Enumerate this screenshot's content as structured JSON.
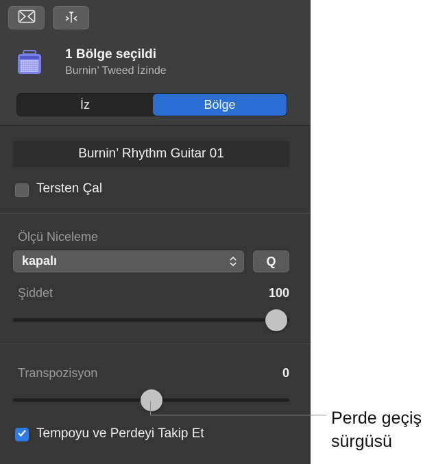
{
  "toolbar": {
    "buttons": [
      {
        "icon": "region-inspector-icon"
      },
      {
        "icon": "catch-playhead-icon"
      }
    ]
  },
  "header": {
    "title": "1 Bölge seçildi",
    "subtitle": "Burnin’ Tweed İzinde",
    "icon": "amp-icon"
  },
  "tabs": {
    "left_label": "İz",
    "right_label": "Bölge",
    "selected": "Bölge"
  },
  "region": {
    "name": "Burnin’ Rhythm Guitar 01",
    "reverse_label": "Tersten Çal",
    "reverse_checked": false
  },
  "quantize": {
    "label": "Ölçü Niceleme",
    "value": "kapalı",
    "q_button_label": "Q"
  },
  "velocity": {
    "label": "Şiddet",
    "value": "100",
    "slider_fraction": 1.0
  },
  "transpose": {
    "label": "Transpozisyon",
    "value": "0",
    "slider_fraction": 0.5
  },
  "follow": {
    "label": "Tempoyu ve Perdeyi Takip Et",
    "checked": true
  },
  "callout": {
    "line1": "Perde geçiş",
    "line2": "sürgüsü"
  },
  "colors": {
    "accent": "#2a6fd1",
    "checkbox_on": "#2f7ae5",
    "amp_icon": "#7b7fe8"
  }
}
